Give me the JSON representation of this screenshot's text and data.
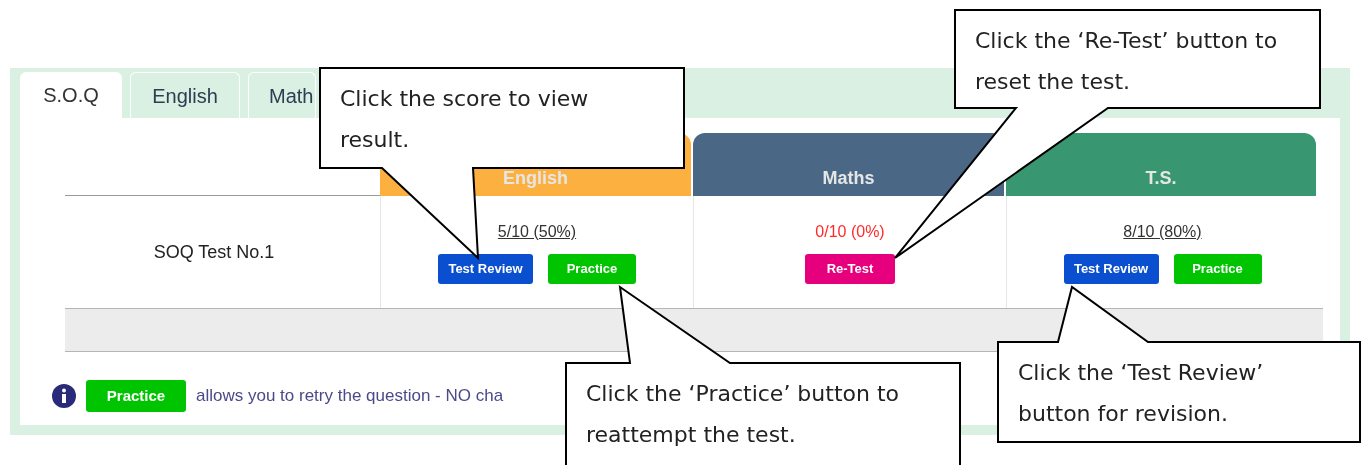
{
  "tabs": [
    {
      "label": "S.O.Q",
      "selected": true
    },
    {
      "label": "English",
      "selected": false
    },
    {
      "label": "Math",
      "selected": false
    }
  ],
  "table": {
    "columns": [
      {
        "label": "English",
        "color": "#fbb040"
      },
      {
        "label": "Maths",
        "color": "#4a6785"
      },
      {
        "label": "T.S.",
        "color": "#389670"
      }
    ],
    "rows": [
      {
        "name": "SOQ Test No.1",
        "cells": [
          {
            "score": "5/10 (50%)",
            "kind": "link",
            "buttons": [
              {
                "label": "Test Review",
                "kind": "review"
              },
              {
                "label": "Practice",
                "kind": "practice"
              }
            ]
          },
          {
            "score": "0/10 (0%)",
            "kind": "fail",
            "buttons": [
              {
                "label": "Re-Test",
                "kind": "retest"
              }
            ]
          },
          {
            "score": "8/10 (80%)",
            "kind": "link",
            "buttons": [
              {
                "label": "Test Review",
                "kind": "review"
              },
              {
                "label": "Practice",
                "kind": "practice"
              }
            ]
          }
        ]
      }
    ]
  },
  "note": {
    "badge": "Practice",
    "text": "allows you to retry the question - NO cha"
  },
  "callouts": [
    {
      "text": "Click the score to view result."
    },
    {
      "text": "Click the ‘Re-Test’ button to reset the test."
    },
    {
      "text": "Click the ‘Practice’ button to reattempt the test."
    },
    {
      "text": "Click the ‘Test Review’ button for revision."
    }
  ]
}
